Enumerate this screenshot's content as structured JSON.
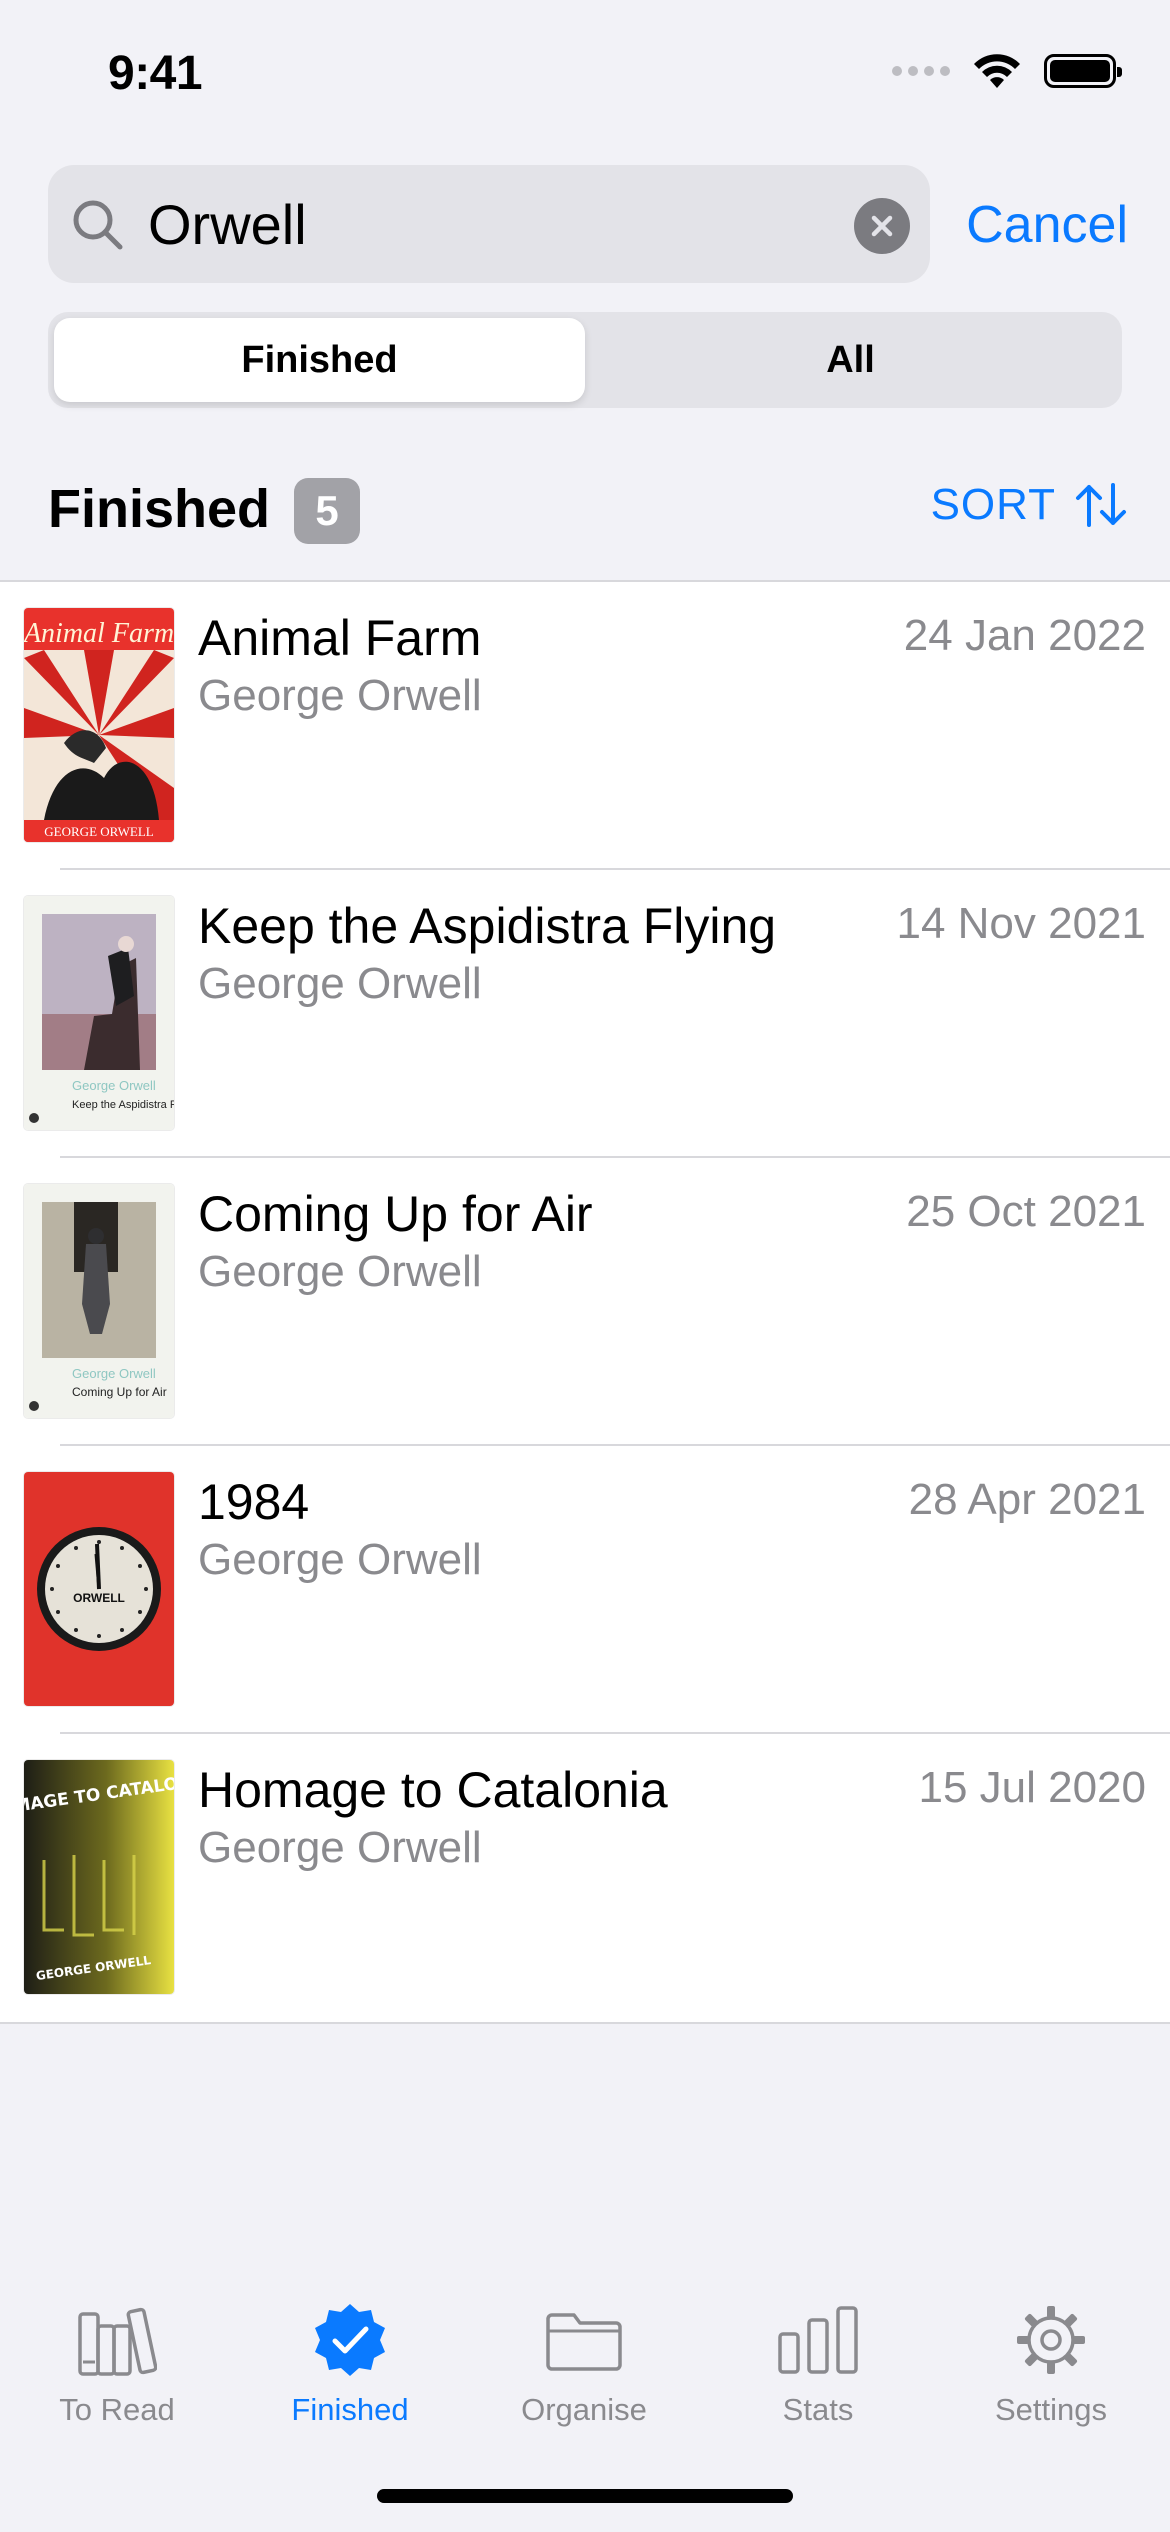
{
  "status_bar": {
    "time": "9:41"
  },
  "search": {
    "query": "Orwell",
    "cancel_label": "Cancel"
  },
  "segmented": {
    "options": [
      "Finished",
      "All"
    ],
    "selected": "Finished"
  },
  "section": {
    "title": "Finished",
    "count": "5",
    "sort_label": "SORT"
  },
  "books": [
    {
      "title": "Animal Farm",
      "author": "George Orwell",
      "date": "24 Jan 2022",
      "cover_icon": "animal-farm-cover"
    },
    {
      "title": "Keep the Aspidistra Flying",
      "author": "George Orwell",
      "date": "14 Nov 2021",
      "cover_icon": "aspidistra-cover"
    },
    {
      "title": "Coming Up for Air",
      "author": "George Orwell",
      "date": "25 Oct 2021",
      "cover_icon": "coming-up-for-air-cover"
    },
    {
      "title": "1984",
      "author": "George Orwell",
      "date": "28 Apr 2021",
      "cover_icon": "nineteen-eighty-four-cover"
    },
    {
      "title": "Homage to Catalonia",
      "author": "George Orwell",
      "date": "15 Jul 2020",
      "cover_icon": "homage-to-catalonia-cover"
    }
  ],
  "covers_text": {
    "animal_farm": {
      "title": "Animal Farm",
      "author": "GEORGE ORWELL"
    },
    "aspidistra": {
      "author": "George Orwell",
      "title": "Keep the Aspidistra Flying"
    },
    "coming_up": {
      "author": "George Orwell",
      "title": "Coming Up for Air"
    },
    "nineteen": {
      "author": "ORWELL"
    },
    "homage": {
      "title": "HOMAGE TO CATALONIA",
      "author": "GEORGE ORWELL"
    }
  },
  "tab_bar": {
    "tabs": [
      {
        "label": "To Read",
        "icon": "books-icon"
      },
      {
        "label": "Finished",
        "icon": "checkmark-seal-icon"
      },
      {
        "label": "Organise",
        "icon": "folder-icon"
      },
      {
        "label": "Stats",
        "icon": "bar-chart-icon"
      },
      {
        "label": "Settings",
        "icon": "gear-icon"
      }
    ],
    "active": "Finished"
  },
  "colors": {
    "accent": "#0A7AFF",
    "secondary_text": "#8A8A8E",
    "background": "#F2F2F7"
  }
}
